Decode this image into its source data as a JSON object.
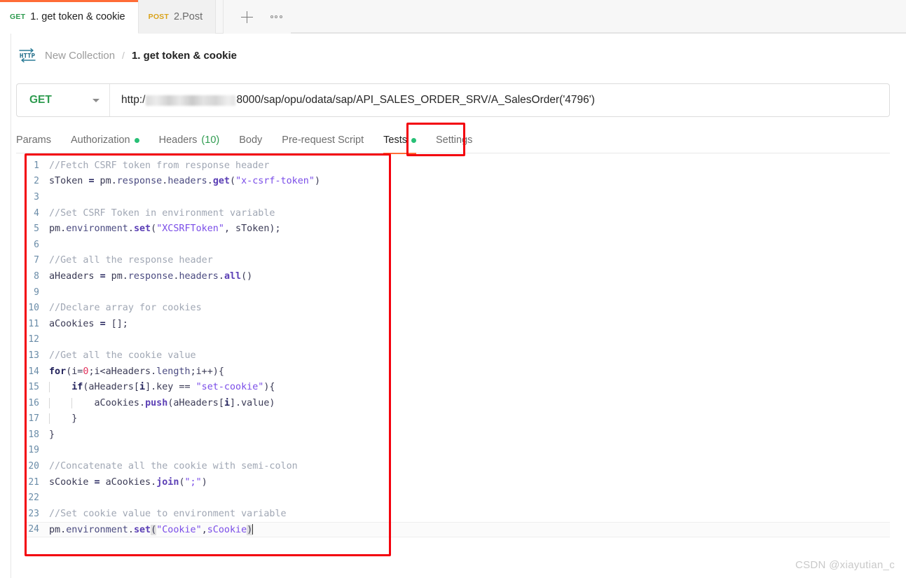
{
  "window": {
    "accent_orange": "#ff6c37",
    "annotation_color": "#f3000c"
  },
  "tabstrip": {
    "tabs": [
      {
        "verb": "GET",
        "title": "1. get token & cookie",
        "active": true
      },
      {
        "verb": "POST",
        "title": "2.Post",
        "active": false
      }
    ],
    "new_tab_icon": "plus-icon",
    "more_icon": "ellipsis-icon"
  },
  "breadcrumb": {
    "protocol_icon": "http-icon",
    "collection": "New Collection",
    "separator": "/",
    "current": "1. get token & cookie"
  },
  "request": {
    "method": "GET",
    "method_color": "#2e9b4f",
    "url_prefix": "http:/",
    "url_redacted": true,
    "url_suffix": "8000/sap/opu/odata/sap/API_SALES_ORDER_SRV/A_SalesOrder('4796')"
  },
  "subtabs": [
    {
      "label": "Params",
      "badge": "",
      "dot": false,
      "active": false
    },
    {
      "label": "Authorization",
      "badge": "",
      "dot": true,
      "active": false
    },
    {
      "label": "Headers",
      "badge": "(10)",
      "dot": false,
      "active": false
    },
    {
      "label": "Body",
      "badge": "",
      "dot": false,
      "active": false
    },
    {
      "label": "Pre-request Script",
      "badge": "",
      "dot": false,
      "active": false
    },
    {
      "label": "Tests",
      "badge": "",
      "dot": true,
      "active": true
    },
    {
      "label": "Settings",
      "badge": "",
      "dot": false,
      "active": false
    }
  ],
  "editor": {
    "language": "javascript",
    "total_lines": 24,
    "active_line": 24,
    "lines": [
      {
        "n": "1",
        "text": "//Fetch CSRF token from response header"
      },
      {
        "n": "2",
        "text": "sToken = pm.response.headers.get(\"x-csrf-token\")"
      },
      {
        "n": "3",
        "text": ""
      },
      {
        "n": "4",
        "text": "//Set CSRF Token in environment variable"
      },
      {
        "n": "5",
        "text": "pm.environment.set(\"XCSRFToken\", sToken);"
      },
      {
        "n": "6",
        "text": ""
      },
      {
        "n": "7",
        "text": "//Get all the response header"
      },
      {
        "n": "8",
        "text": "aHeaders = pm.response.headers.all()"
      },
      {
        "n": "9",
        "text": ""
      },
      {
        "n": "10",
        "text": "//Declare array for cookies"
      },
      {
        "n": "11",
        "text": "aCookies = [];"
      },
      {
        "n": "12",
        "text": ""
      },
      {
        "n": "13",
        "text": "//Get all the cookie value"
      },
      {
        "n": "14",
        "text": "for(i=0;i<aHeaders.length;i++){"
      },
      {
        "n": "15",
        "text": "    if(aHeaders[i].key == \"set-cookie\"){"
      },
      {
        "n": "16",
        "text": "        aCookies.push(aHeaders[i].value)"
      },
      {
        "n": "17",
        "text": "    }"
      },
      {
        "n": "18",
        "text": "}"
      },
      {
        "n": "19",
        "text": ""
      },
      {
        "n": "20",
        "text": "//Concatenate all the cookie with semi-colon"
      },
      {
        "n": "21",
        "text": "sCookie = aCookies.join(\";\")"
      },
      {
        "n": "22",
        "text": ""
      },
      {
        "n": "23",
        "text": "//Set cookie value to environment variable"
      },
      {
        "n": "24",
        "text": "pm.environment.set(\"Cookie\",sCookie)"
      }
    ],
    "colors": {
      "comment": "#a0a7b4",
      "keyword": "#23235c",
      "function": "#5b3fb5",
      "string": "#7a4de8",
      "number": "#e2325c",
      "plain": "#3a3a55",
      "line_number": "#6a8ca8"
    }
  },
  "watermark": "CSDN @xiayutian_c"
}
